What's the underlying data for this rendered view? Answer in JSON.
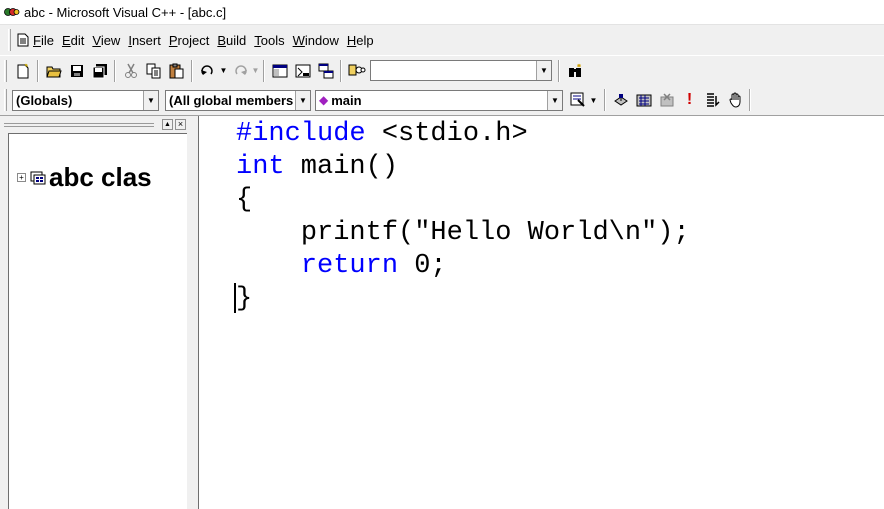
{
  "window": {
    "title": "abc - Microsoft Visual C++ - [abc.c]"
  },
  "menubar": {
    "items": [
      {
        "first": "F",
        "rest": "ile"
      },
      {
        "first": "E",
        "rest": "dit"
      },
      {
        "first": "V",
        "rest": "iew"
      },
      {
        "first": "I",
        "rest": "nsert"
      },
      {
        "first": "P",
        "rest": "roject"
      },
      {
        "first": "B",
        "rest": "uild"
      },
      {
        "first": "T",
        "rest": "ools"
      },
      {
        "first": "W",
        "rest": "indow"
      },
      {
        "first": "H",
        "rest": "elp"
      }
    ]
  },
  "toolbar": {
    "find_value": ""
  },
  "wizardbar": {
    "class_combo": "(Globals)",
    "filter_combo": "(All global members",
    "member_combo": "main"
  },
  "workspace": {
    "tree_root_label": "abc clas"
  },
  "editor": {
    "lines": [
      {
        "kw": "#include",
        "rest": " <stdio.h>"
      },
      {
        "kw": "int",
        "rest": " main()"
      },
      {
        "kw": "",
        "rest": "{"
      },
      {
        "kw": "",
        "indent": "    ",
        "rest": "printf(\"Hello World\\n\");"
      },
      {
        "kw": "return",
        "indent": "    ",
        "rest": " 0;"
      },
      {
        "kw": "",
        "rest": "}"
      }
    ]
  },
  "colors": {
    "keyword": "#0000ff",
    "chrome": "#f0f0f0"
  }
}
